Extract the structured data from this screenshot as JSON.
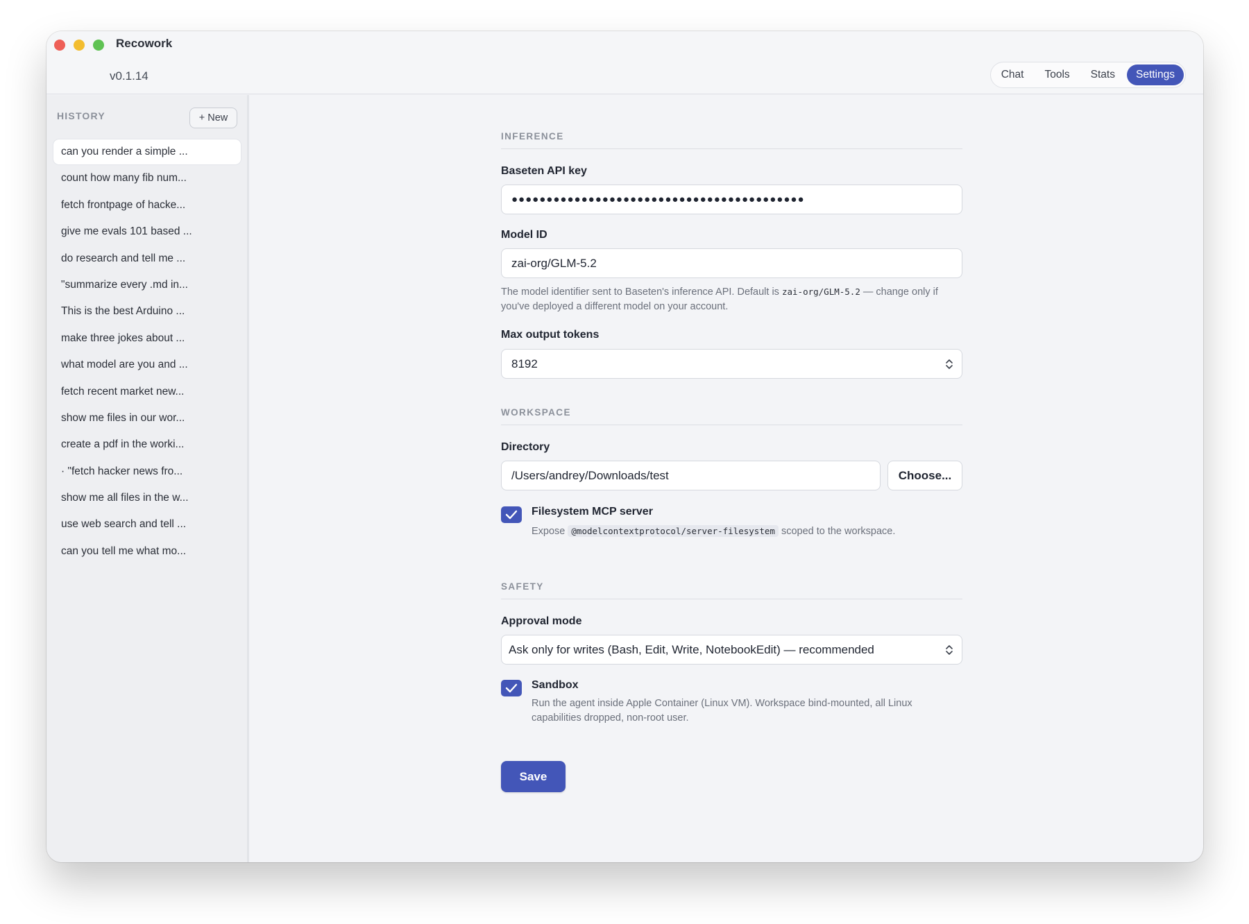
{
  "window": {
    "title": "Recowork",
    "version": "v0.1.14"
  },
  "tabs": [
    {
      "label": "Chat",
      "active": false
    },
    {
      "label": "Tools",
      "active": false
    },
    {
      "label": "Stats",
      "active": false
    },
    {
      "label": "Settings",
      "active": true
    }
  ],
  "sidebar": {
    "heading": "HISTORY",
    "new_button": "+ New",
    "items": [
      "can you render a simple ...",
      "count how many fib num...",
      "fetch frontpage of hacke...",
      "give me evals 101 based ...",
      "do research and tell me ...",
      "\"summarize every .md in...",
      "This is the best Arduino ...",
      "make three jokes about ...",
      "what model are you and ...",
      "fetch recent market new...",
      "show me files in our wor...",
      "create a pdf in the worki...",
      "· \"fetch hacker news fro...",
      "show me all files in the w...",
      "use web search and tell ...",
      "can you tell me what mo..."
    ]
  },
  "settings": {
    "inference": {
      "section_title": "INFERENCE",
      "api_key_label": "Baseten API key",
      "api_key_value": "●●●●●●●●●●●●●●●●●●●●●●●●●●●●●●●●●●●●●●●●●●",
      "model_id_label": "Model ID",
      "model_id_value": "zai-org/GLM-5.2",
      "model_help_prefix": "The model identifier sent to Baseten's inference API. Default is",
      "model_help_code": "zai-org/GLM-5.2",
      "model_help_suffix": "— change only if you've deployed a different model on your account.",
      "max_tokens_label": "Max output tokens",
      "max_tokens_value": "8192"
    },
    "workspace": {
      "section_title": "WORKSPACE",
      "directory_label": "Directory",
      "directory_value": "/Users/andrey/Downloads/test",
      "choose_button": "Choose...",
      "fs_mcp_label": "Filesystem MCP server",
      "fs_mcp_checked": true,
      "fs_mcp_desc_prefix": "Expose",
      "fs_mcp_desc_code": "@modelcontextprotocol/server-filesystem",
      "fs_mcp_desc_suffix": "scoped to the workspace."
    },
    "safety": {
      "section_title": "SAFETY",
      "approval_label": "Approval mode",
      "approval_value": "Ask only for writes (Bash, Edit, Write, NotebookEdit) — recommended",
      "sandbox_label": "Sandbox",
      "sandbox_checked": true,
      "sandbox_desc": "Run the agent inside Apple Container (Linux VM). Workspace bind-mounted, all Linux capabilities dropped, non-root user."
    },
    "save_button": "Save"
  },
  "colors": {
    "accent": "#4356b8",
    "traffic_red": "#ee5f57",
    "traffic_yellow": "#f3bd2f",
    "traffic_green": "#5fc253"
  }
}
